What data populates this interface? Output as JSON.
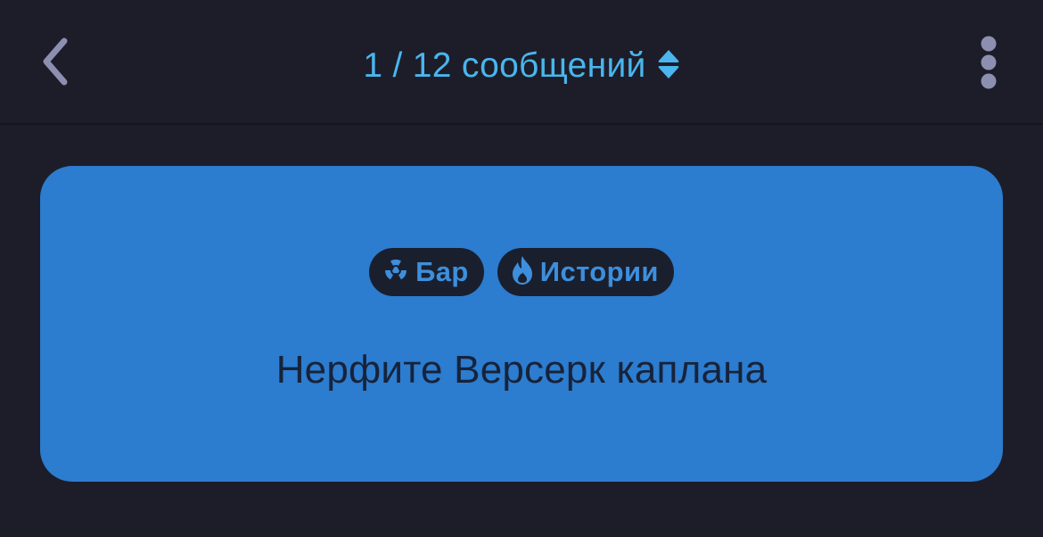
{
  "header": {
    "title": "1 / 12 сообщений",
    "back_icon": "chevron-left-icon",
    "sort_icon": "up-down-arrows-icon",
    "more_icon": "vertical-ellipsis-icon"
  },
  "card": {
    "tags": [
      {
        "label": "Бар",
        "icon": "radiation-icon"
      },
      {
        "label": "Истории",
        "icon": "flame-icon"
      }
    ],
    "message": "Нерфите Версерк каплана"
  },
  "colors": {
    "background": "#1c1d28",
    "accent": "#4ab5ee",
    "card": "#2c7ccf",
    "tag_bg": "#1a1f2e",
    "tag_text": "#3d8fdd"
  }
}
